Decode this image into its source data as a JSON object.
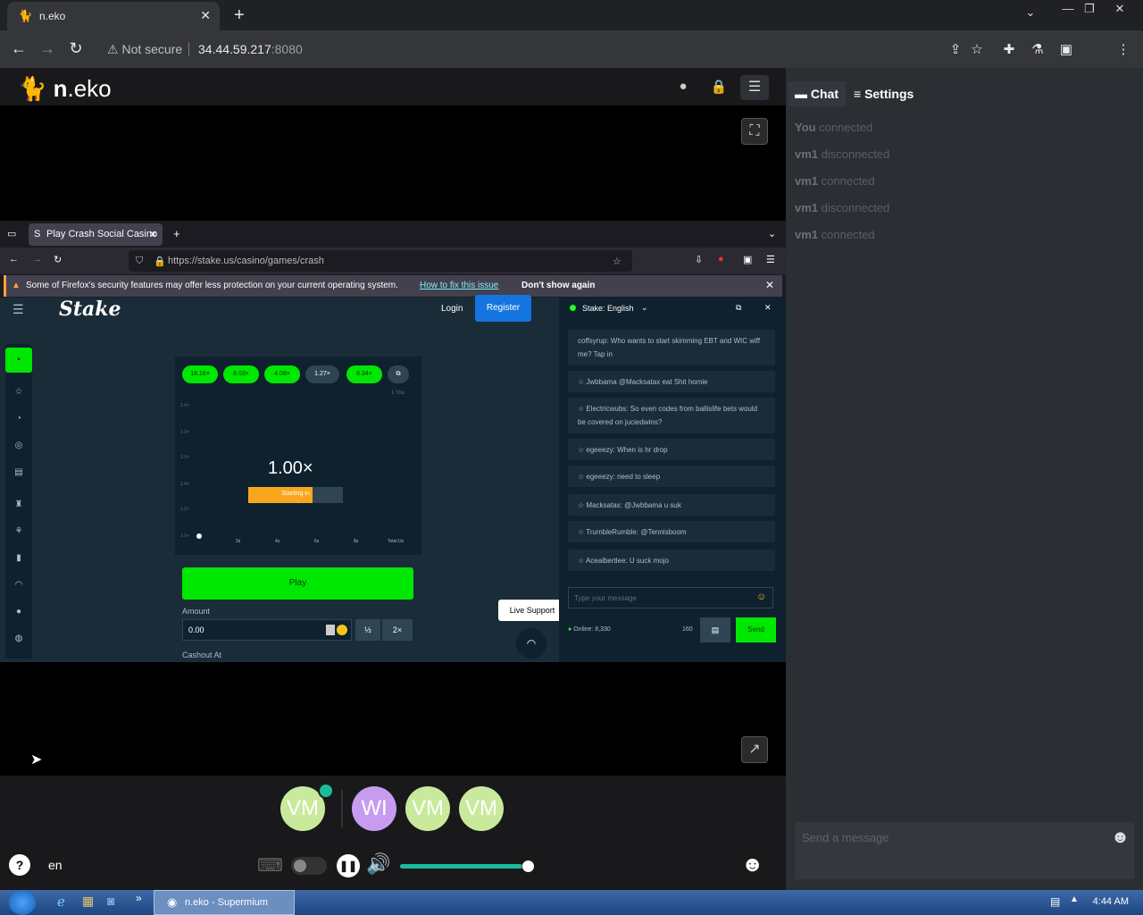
{
  "chrome": {
    "tab_title": "n.eko",
    "security": "Not secure",
    "url_host": "34.44.59.217",
    "url_port": ":8080"
  },
  "neko": {
    "logo_n": "n",
    "logo_rest": ".eko",
    "members": [
      {
        "initials": "VM",
        "color": "#c9ea9c"
      },
      {
        "initials": "WI",
        "color": "#c79cf0"
      },
      {
        "initials": "VM",
        "color": "#c9ea9c"
      },
      {
        "initials": "VM",
        "color": "#c9ea9c"
      }
    ],
    "language": "en",
    "volume_fraction": 0.95,
    "tabs": {
      "chat": "Chat",
      "settings": "Settings"
    },
    "events": [
      {
        "who": "You",
        "what": "connected"
      },
      {
        "who": "vm1",
        "what": "disconnected"
      },
      {
        "who": "vm1",
        "what": "connected"
      },
      {
        "who": "vm1",
        "what": "disconnected"
      },
      {
        "who": "vm1",
        "what": "connected"
      }
    ],
    "message_placeholder": "Send a message"
  },
  "firefox": {
    "tab_title": "Play Crash Social Casino",
    "url": "https://stake.us/casino/games/crash",
    "warning": "Some of Firefox's security features may offer less protection on your current operating system.",
    "warning_link": "How to fix this issue",
    "dont_show": "Don't show again"
  },
  "stake": {
    "logo": "Stake",
    "login": "Login",
    "register": "Register",
    "multipliers": [
      "18.16×",
      "8.03×",
      "4.08×",
      "1.27×",
      "8.34×"
    ],
    "you_label": "1 You",
    "current_multiplier": "1.00×",
    "starting_in": "Starting in",
    "y_ticks": [
      "1.4×",
      "1.2×",
      "1.0×",
      "1.4×",
      "1.2×",
      "1.0×"
    ],
    "x_ticks": [
      "2s",
      "4s",
      "6s",
      "8s",
      "Total Us"
    ],
    "play": "Play",
    "amount_label": "Amount",
    "amount_value": "0.00",
    "half": "½",
    "double": "2×",
    "cashout_label": "Cashout At",
    "live_support": "Live Support",
    "chat_header": "Stake: English",
    "chat_messages": [
      {
        "name": "coffsyrup:",
        "text": "Who wants to start skimming EBT and WIC wiff me? Tap in"
      },
      {
        "name": "Jwbbama",
        "text": "@Macksatax  eat Shit homie"
      },
      {
        "name": "Electricwubs:",
        "text": "So even codes from ballislife bets would be covered on juciedwins?"
      },
      {
        "name": "egeeezy:",
        "text": "When is hr drop"
      },
      {
        "name": "egeeezy:",
        "text": "need to sleep"
      },
      {
        "name": "Macksatax:",
        "text": "@Jwbbama  u suk"
      },
      {
        "name": "TrumbleRumble:",
        "text": "@Tennisboom"
      },
      {
        "name": "Acealbertlee:",
        "text": "U suck mojo"
      }
    ],
    "chat_placeholder": "Type your message",
    "online": "Online: 8,330",
    "count": "160",
    "send": "Send"
  },
  "taskbar": {
    "item": "n.eko - Supermium",
    "time": "4:44 AM"
  }
}
